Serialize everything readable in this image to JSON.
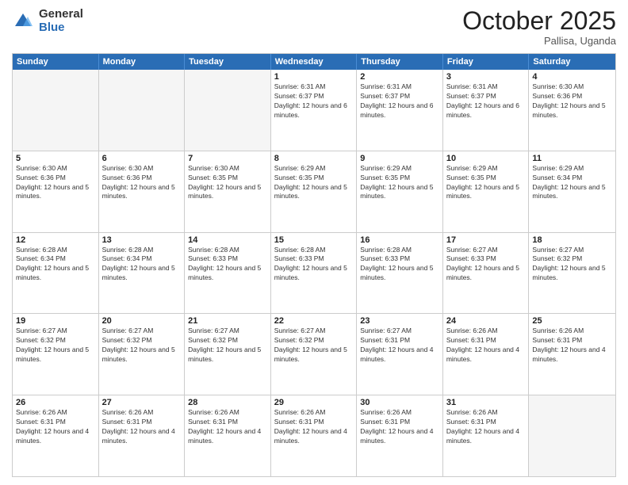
{
  "header": {
    "logo_general": "General",
    "logo_blue": "Blue",
    "month_title": "October 2025",
    "subtitle": "Pallisa, Uganda"
  },
  "calendar": {
    "days_of_week": [
      "Sunday",
      "Monday",
      "Tuesday",
      "Wednesday",
      "Thursday",
      "Friday",
      "Saturday"
    ],
    "rows": [
      [
        {
          "day": "",
          "empty": true
        },
        {
          "day": "",
          "empty": true
        },
        {
          "day": "",
          "empty": true
        },
        {
          "day": "1",
          "sunrise": "Sunrise: 6:31 AM",
          "sunset": "Sunset: 6:37 PM",
          "daylight": "Daylight: 12 hours and 6 minutes."
        },
        {
          "day": "2",
          "sunrise": "Sunrise: 6:31 AM",
          "sunset": "Sunset: 6:37 PM",
          "daylight": "Daylight: 12 hours and 6 minutes."
        },
        {
          "day": "3",
          "sunrise": "Sunrise: 6:31 AM",
          "sunset": "Sunset: 6:37 PM",
          "daylight": "Daylight: 12 hours and 6 minutes."
        },
        {
          "day": "4",
          "sunrise": "Sunrise: 6:30 AM",
          "sunset": "Sunset: 6:36 PM",
          "daylight": "Daylight: 12 hours and 5 minutes."
        }
      ],
      [
        {
          "day": "5",
          "sunrise": "Sunrise: 6:30 AM",
          "sunset": "Sunset: 6:36 PM",
          "daylight": "Daylight: 12 hours and 5 minutes."
        },
        {
          "day": "6",
          "sunrise": "Sunrise: 6:30 AM",
          "sunset": "Sunset: 6:36 PM",
          "daylight": "Daylight: 12 hours and 5 minutes."
        },
        {
          "day": "7",
          "sunrise": "Sunrise: 6:30 AM",
          "sunset": "Sunset: 6:35 PM",
          "daylight": "Daylight: 12 hours and 5 minutes."
        },
        {
          "day": "8",
          "sunrise": "Sunrise: 6:29 AM",
          "sunset": "Sunset: 6:35 PM",
          "daylight": "Daylight: 12 hours and 5 minutes."
        },
        {
          "day": "9",
          "sunrise": "Sunrise: 6:29 AM",
          "sunset": "Sunset: 6:35 PM",
          "daylight": "Daylight: 12 hours and 5 minutes."
        },
        {
          "day": "10",
          "sunrise": "Sunrise: 6:29 AM",
          "sunset": "Sunset: 6:35 PM",
          "daylight": "Daylight: 12 hours and 5 minutes."
        },
        {
          "day": "11",
          "sunrise": "Sunrise: 6:29 AM",
          "sunset": "Sunset: 6:34 PM",
          "daylight": "Daylight: 12 hours and 5 minutes."
        }
      ],
      [
        {
          "day": "12",
          "sunrise": "Sunrise: 6:28 AM",
          "sunset": "Sunset: 6:34 PM",
          "daylight": "Daylight: 12 hours and 5 minutes."
        },
        {
          "day": "13",
          "sunrise": "Sunrise: 6:28 AM",
          "sunset": "Sunset: 6:34 PM",
          "daylight": "Daylight: 12 hours and 5 minutes."
        },
        {
          "day": "14",
          "sunrise": "Sunrise: 6:28 AM",
          "sunset": "Sunset: 6:33 PM",
          "daylight": "Daylight: 12 hours and 5 minutes."
        },
        {
          "day": "15",
          "sunrise": "Sunrise: 6:28 AM",
          "sunset": "Sunset: 6:33 PM",
          "daylight": "Daylight: 12 hours and 5 minutes."
        },
        {
          "day": "16",
          "sunrise": "Sunrise: 6:28 AM",
          "sunset": "Sunset: 6:33 PM",
          "daylight": "Daylight: 12 hours and 5 minutes."
        },
        {
          "day": "17",
          "sunrise": "Sunrise: 6:27 AM",
          "sunset": "Sunset: 6:33 PM",
          "daylight": "Daylight: 12 hours and 5 minutes."
        },
        {
          "day": "18",
          "sunrise": "Sunrise: 6:27 AM",
          "sunset": "Sunset: 6:32 PM",
          "daylight": "Daylight: 12 hours and 5 minutes."
        }
      ],
      [
        {
          "day": "19",
          "sunrise": "Sunrise: 6:27 AM",
          "sunset": "Sunset: 6:32 PM",
          "daylight": "Daylight: 12 hours and 5 minutes."
        },
        {
          "day": "20",
          "sunrise": "Sunrise: 6:27 AM",
          "sunset": "Sunset: 6:32 PM",
          "daylight": "Daylight: 12 hours and 5 minutes."
        },
        {
          "day": "21",
          "sunrise": "Sunrise: 6:27 AM",
          "sunset": "Sunset: 6:32 PM",
          "daylight": "Daylight: 12 hours and 5 minutes."
        },
        {
          "day": "22",
          "sunrise": "Sunrise: 6:27 AM",
          "sunset": "Sunset: 6:32 PM",
          "daylight": "Daylight: 12 hours and 5 minutes."
        },
        {
          "day": "23",
          "sunrise": "Sunrise: 6:27 AM",
          "sunset": "Sunset: 6:31 PM",
          "daylight": "Daylight: 12 hours and 4 minutes."
        },
        {
          "day": "24",
          "sunrise": "Sunrise: 6:26 AM",
          "sunset": "Sunset: 6:31 PM",
          "daylight": "Daylight: 12 hours and 4 minutes."
        },
        {
          "day": "25",
          "sunrise": "Sunrise: 6:26 AM",
          "sunset": "Sunset: 6:31 PM",
          "daylight": "Daylight: 12 hours and 4 minutes."
        }
      ],
      [
        {
          "day": "26",
          "sunrise": "Sunrise: 6:26 AM",
          "sunset": "Sunset: 6:31 PM",
          "daylight": "Daylight: 12 hours and 4 minutes."
        },
        {
          "day": "27",
          "sunrise": "Sunrise: 6:26 AM",
          "sunset": "Sunset: 6:31 PM",
          "daylight": "Daylight: 12 hours and 4 minutes."
        },
        {
          "day": "28",
          "sunrise": "Sunrise: 6:26 AM",
          "sunset": "Sunset: 6:31 PM",
          "daylight": "Daylight: 12 hours and 4 minutes."
        },
        {
          "day": "29",
          "sunrise": "Sunrise: 6:26 AM",
          "sunset": "Sunset: 6:31 PM",
          "daylight": "Daylight: 12 hours and 4 minutes."
        },
        {
          "day": "30",
          "sunrise": "Sunrise: 6:26 AM",
          "sunset": "Sunset: 6:31 PM",
          "daylight": "Daylight: 12 hours and 4 minutes."
        },
        {
          "day": "31",
          "sunrise": "Sunrise: 6:26 AM",
          "sunset": "Sunset: 6:31 PM",
          "daylight": "Daylight: 12 hours and 4 minutes."
        },
        {
          "day": "",
          "empty": true
        }
      ]
    ]
  }
}
